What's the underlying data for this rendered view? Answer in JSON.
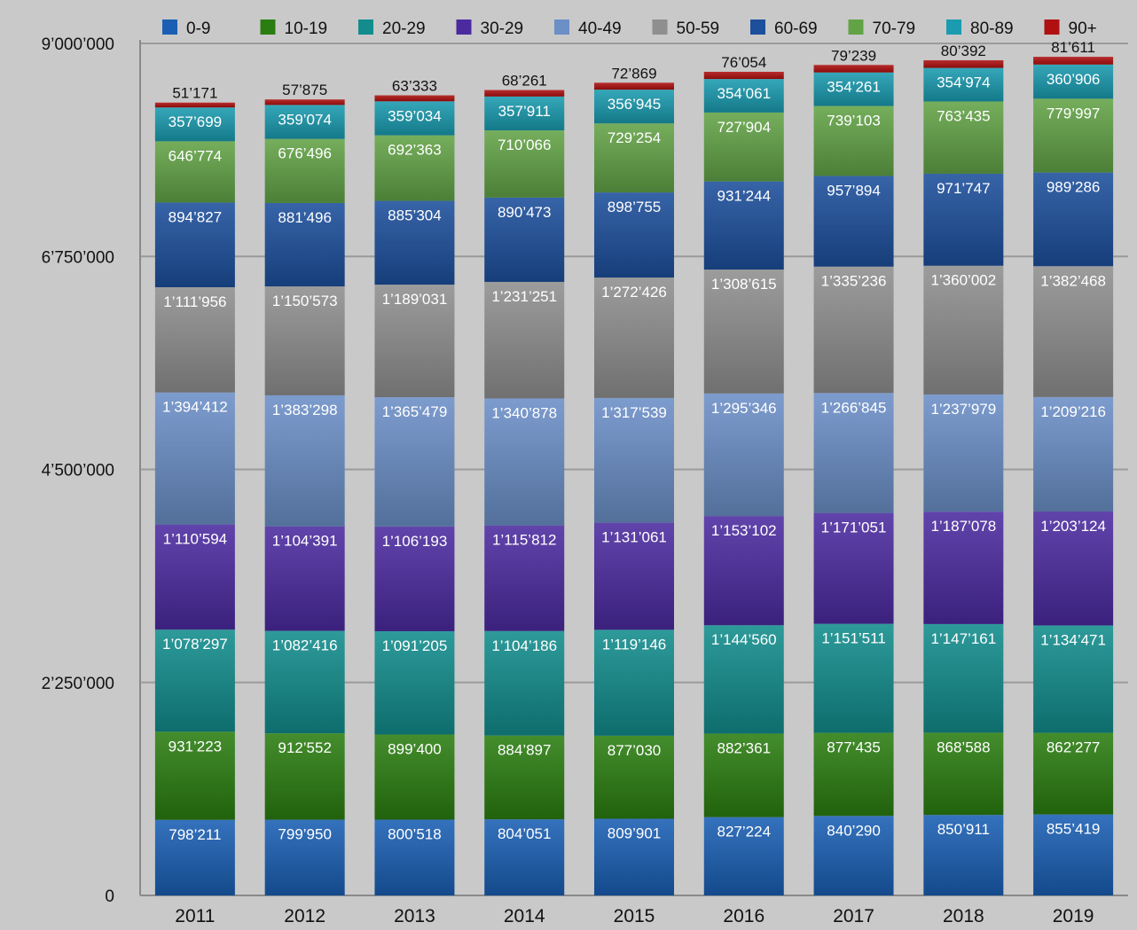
{
  "chart_data": {
    "type": "bar",
    "stacked": true,
    "title": "",
    "xlabel": "",
    "ylabel": "",
    "ylim": [
      0,
      9000000
    ],
    "yticks": [
      0,
      2250000,
      4500000,
      6750000,
      9000000
    ],
    "ytick_labels": [
      "0",
      "2’250’000",
      "4’500’000",
      "6’750’000",
      "9’000’000"
    ],
    "grid": true,
    "legend_position": "top",
    "categories": [
      "2011",
      "2012",
      "2013",
      "2014",
      "2015",
      "2016",
      "2017",
      "2018",
      "2019"
    ],
    "series": [
      {
        "name": "0-9",
        "color": "#1a5fb4",
        "values": [
          798211,
          799950,
          800518,
          804051,
          809901,
          827224,
          840290,
          850911,
          855419
        ],
        "labels": [
          "798’211",
          "799’950",
          "800’518",
          "804’051",
          "809’901",
          "827’224",
          "840’290",
          "850’911",
          "855’419"
        ]
      },
      {
        "name": "10-19",
        "color": "#2a7d10",
        "values": [
          931223,
          912552,
          899400,
          884897,
          877030,
          882361,
          877435,
          868588,
          862277
        ],
        "labels": [
          "931’223",
          "912’552",
          "899’400",
          "884’897",
          "877’030",
          "882’361",
          "877’435",
          "868’588",
          "862’277"
        ]
      },
      {
        "name": "20-29",
        "color": "#128c8c",
        "values": [
          1078297,
          1082416,
          1091205,
          1104186,
          1119146,
          1144560,
          1151511,
          1147161,
          1134471
        ],
        "labels": [
          "1’078’297",
          "1’082’416",
          "1’091’205",
          "1’104’186",
          "1’119’146",
          "1’144’560",
          "1’151’511",
          "1’147’161",
          "1’134’471"
        ]
      },
      {
        "name": "30-29",
        "color": "#4b2aa0",
        "values": [
          1110594,
          1104391,
          1106193,
          1115812,
          1131061,
          1153102,
          1171051,
          1187078,
          1203124
        ],
        "labels": [
          "1’110’594",
          "1’104’391",
          "1’106’193",
          "1’115’812",
          "1’131’061",
          "1’153’102",
          "1’171’051",
          "1’187’078",
          "1’203’124"
        ]
      },
      {
        "name": "40-49",
        "color": "#6b8fc7",
        "values": [
          1394412,
          1383298,
          1365479,
          1340878,
          1317539,
          1295346,
          1266845,
          1237979,
          1209216
        ],
        "labels": [
          "1’394’412",
          "1’383’298",
          "1’365’479",
          "1’340’878",
          "1’317’539",
          "1’295’346",
          "1’266’845",
          "1’237’979",
          "1’209’216"
        ]
      },
      {
        "name": "50-59",
        "color": "#8f8f8f",
        "values": [
          1111956,
          1150573,
          1189031,
          1231251,
          1272426,
          1308615,
          1335236,
          1360002,
          1382468
        ],
        "labels": [
          "1’111’956",
          "1’150’573",
          "1’189’031",
          "1’231’251",
          "1’272’426",
          "1’308’615",
          "1’335’236",
          "1’360’002",
          "1’382’468"
        ]
      },
      {
        "name": "60-69",
        "color": "#1c4f9c",
        "values": [
          894827,
          881496,
          885304,
          890473,
          898755,
          931244,
          957894,
          971747,
          989286
        ],
        "labels": [
          "894’827",
          "881’496",
          "885’304",
          "890’473",
          "898’755",
          "931’244",
          "957’894",
          "971’747",
          "989’286"
        ]
      },
      {
        "name": "70-79",
        "color": "#62a346",
        "values": [
          646774,
          676496,
          692363,
          710066,
          729254,
          727904,
          739103,
          763435,
          779997
        ],
        "labels": [
          "646’774",
          "676’496",
          "692’363",
          "710’066",
          "729’254",
          "727’904",
          "739’103",
          "763’435",
          "779’997"
        ]
      },
      {
        "name": "80-89",
        "color": "#1a9bb0",
        "values": [
          357699,
          359074,
          359034,
          357911,
          356945,
          354061,
          354261,
          354974,
          360906
        ],
        "labels": [
          "357’699",
          "359’074",
          "359’034",
          "357’911",
          "356’945",
          "354’061",
          "354’261",
          "354’974",
          "360’906"
        ]
      },
      {
        "name": "90+",
        "color": "#b01010",
        "values": [
          51171,
          57875,
          63333,
          68261,
          72869,
          76054,
          79239,
          80392,
          81611
        ],
        "labels": [
          "51’171",
          "57’875",
          "63’333",
          "68’261",
          "72’869",
          "76’054",
          "79’239",
          "80’392",
          "81’611"
        ]
      }
    ]
  }
}
